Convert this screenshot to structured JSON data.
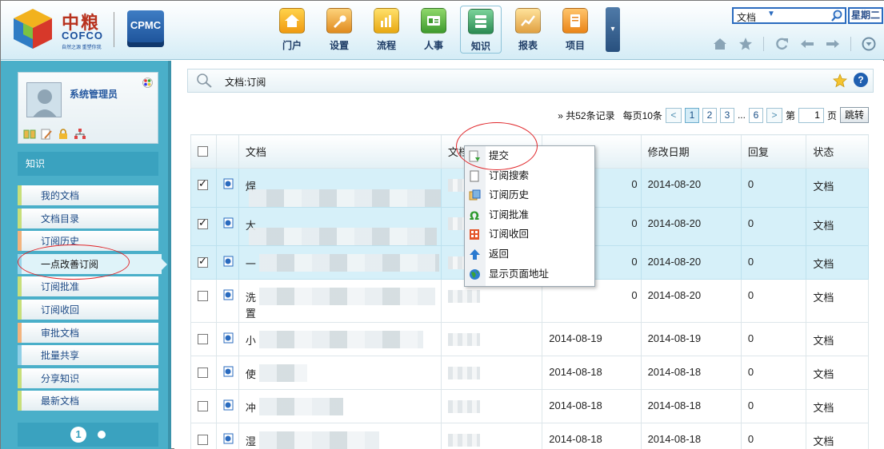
{
  "header": {
    "brand_cn": "中粮",
    "brand_en": "COFCO",
    "brand_tagline": "自然之源 重塑你我",
    "cpmc": "CPMC",
    "nav": [
      {
        "label": "门户",
        "color": "#f0a020"
      },
      {
        "label": "设置",
        "color": "#e89c2c"
      },
      {
        "label": "流程",
        "color": "#e8b41e"
      },
      {
        "label": "人事",
        "color": "#5fb84a"
      },
      {
        "label": "知识",
        "color": "#3f9a6a",
        "active": true
      },
      {
        "label": "报表",
        "color": "#e8a83a"
      },
      {
        "label": "项目",
        "color": "#ef9228"
      }
    ],
    "search_scope": "文档",
    "weekday": "星期二"
  },
  "sidebar": {
    "username": "系统管理员",
    "module_title": "知识",
    "items": [
      {
        "label": "我的文档",
        "style": ""
      },
      {
        "label": "文档目录",
        "style": ""
      },
      {
        "label": "订阅历史",
        "style": "or"
      },
      {
        "label": "一点改善订阅",
        "style": "active"
      },
      {
        "label": "订阅批准",
        "style": ""
      },
      {
        "label": "订阅收回",
        "style": ""
      },
      {
        "label": "审批文档",
        "style": "or"
      },
      {
        "label": "批量共享",
        "style": "bl"
      },
      {
        "label": "分享知识",
        "style": ""
      },
      {
        "label": "最新文档",
        "style": ""
      }
    ],
    "page_current": "1"
  },
  "main": {
    "breadcrumb": "文档:订阅",
    "pagination": {
      "summary": "» 共52条记录",
      "per_page": "每页10条",
      "pages": [
        "1",
        "2",
        "3"
      ],
      "ellipsis": "...",
      "last_page": "6",
      "goto_prefix": "第",
      "goto_value": "1",
      "goto_suffix": "页",
      "goto_button": "跳转"
    },
    "columns": [
      "文档",
      "文档",
      "",
      "修改日期",
      "回复",
      "状态"
    ],
    "rows": [
      {
        "checked": true,
        "title_start": "焊",
        "created": "",
        "modified": "2014-08-20",
        "replies": "0",
        "status": "文档",
        "selected": true,
        "created_suffix": "0"
      },
      {
        "checked": true,
        "title_start": "大",
        "created": "",
        "modified": "2014-08-20",
        "replies": "0",
        "status": "文档",
        "selected": true,
        "created_suffix": "0"
      },
      {
        "checked": true,
        "title_start": "一",
        "created": "",
        "modified": "2014-08-20",
        "replies": "0",
        "status": "文档",
        "selected": true,
        "created_suffix": "0"
      },
      {
        "checked": false,
        "title_start": "洗",
        "title_line2": "置",
        "created": "",
        "modified": "2014-08-20",
        "replies": "0",
        "status": "文档",
        "selected": false,
        "created_suffix": "0"
      },
      {
        "checked": false,
        "title_start": "小",
        "created": "2014-08-19",
        "modified": "2014-08-19",
        "replies": "0",
        "status": "文档",
        "selected": false
      },
      {
        "checked": false,
        "title_start": "使",
        "created": "2014-08-18",
        "modified": "2014-08-18",
        "replies": "0",
        "status": "文档",
        "selected": false
      },
      {
        "checked": false,
        "title_start": "冲",
        "created": "2014-08-18",
        "modified": "2014-08-18",
        "replies": "0",
        "status": "文档",
        "selected": false
      },
      {
        "checked": false,
        "title_start": "湿",
        "created": "2014-08-18",
        "modified": "2014-08-18",
        "replies": "0",
        "status": "文档",
        "selected": false
      }
    ]
  },
  "context_menu": {
    "items": [
      {
        "label": "提交",
        "icon": "submit-icon"
      },
      {
        "label": "订阅搜索",
        "icon": "search-doc-icon"
      },
      {
        "label": "订阅历史",
        "icon": "history-icon"
      },
      {
        "label": "订阅批准",
        "icon": "omega-icon"
      },
      {
        "label": "订阅收回",
        "icon": "recall-icon"
      },
      {
        "label": "返回",
        "icon": "up-arrow-icon"
      },
      {
        "label": "显示页面地址",
        "icon": "globe-icon"
      }
    ]
  }
}
